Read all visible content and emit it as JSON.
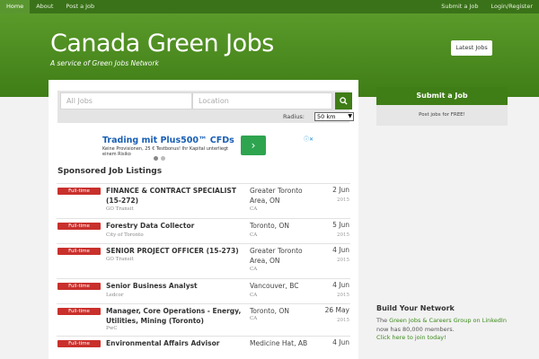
{
  "nav": {
    "left": [
      "Home",
      "About",
      "Post a Job"
    ],
    "right": [
      "Submit a Job",
      "Login/Register"
    ]
  },
  "header": {
    "title": "Canada Green Jobs",
    "tagline": "A service of Green Jobs Network",
    "latest_button": "Latest Jobs"
  },
  "search": {
    "keywords_placeholder": "All Jobs",
    "location_placeholder": "Location",
    "radius_label": "Radius:",
    "radius_value": "50 km"
  },
  "ad": {
    "title": "Trading mit Plus500™ CFDs",
    "description": "Keine Provisionen, 25 € Testbonus! Ihr Kapital unterliegt einem Risiko"
  },
  "listings_title": "Sponsored Job Listings",
  "jobs": [
    {
      "type": "Full-time",
      "title": "FINANCE & CONTRACT SPECIALIST (15-272)",
      "company": "GO Transit",
      "location": "Greater Toronto Area, ON",
      "country": "CA",
      "date": "2 Jun",
      "year": "2015"
    },
    {
      "type": "Full-time",
      "title": "Forestry Data Collector",
      "company": "City of Toronto",
      "location": "Toronto, ON",
      "country": "CA",
      "date": "5 Jun",
      "year": "2015"
    },
    {
      "type": "Full-time",
      "title": "SENIOR PROJECT OFFICER (15-273)",
      "company": "GO Transit",
      "location": "Greater Toronto Area, ON",
      "country": "CA",
      "date": "4 Jun",
      "year": "2015"
    },
    {
      "type": "Full-time",
      "title": "Senior Business Analyst",
      "company": "Ledcor",
      "location": "Vancouver, BC",
      "country": "CA",
      "date": "4 Jun",
      "year": "2015"
    },
    {
      "type": "Full-time",
      "title": "Manager, Core Operations - Energy, Utilities, Mining (Toronto)",
      "company": "PwC",
      "location": "Toronto, ON",
      "country": "CA",
      "date": "26 May",
      "year": "2015"
    },
    {
      "type": "Full-time",
      "title": "Environmental Affairs Advisor",
      "company": "",
      "location": "Medicine Hat, AB",
      "country": "",
      "date": "4 Jun",
      "year": ""
    }
  ],
  "sidebar": {
    "submit_button": "Submit a Job",
    "submit_note": "Post jobs for FREE!",
    "network_title": "Build Your Network",
    "network_pre": "The",
    "network_link": "Green Jobs & Careers Group on LinkedIn",
    "network_mid": "now has 80,000 members.",
    "network_cta": "Click here to join today!"
  },
  "colors": {
    "brand_green": "#3f7d16",
    "badge_red": "#c9302c"
  }
}
